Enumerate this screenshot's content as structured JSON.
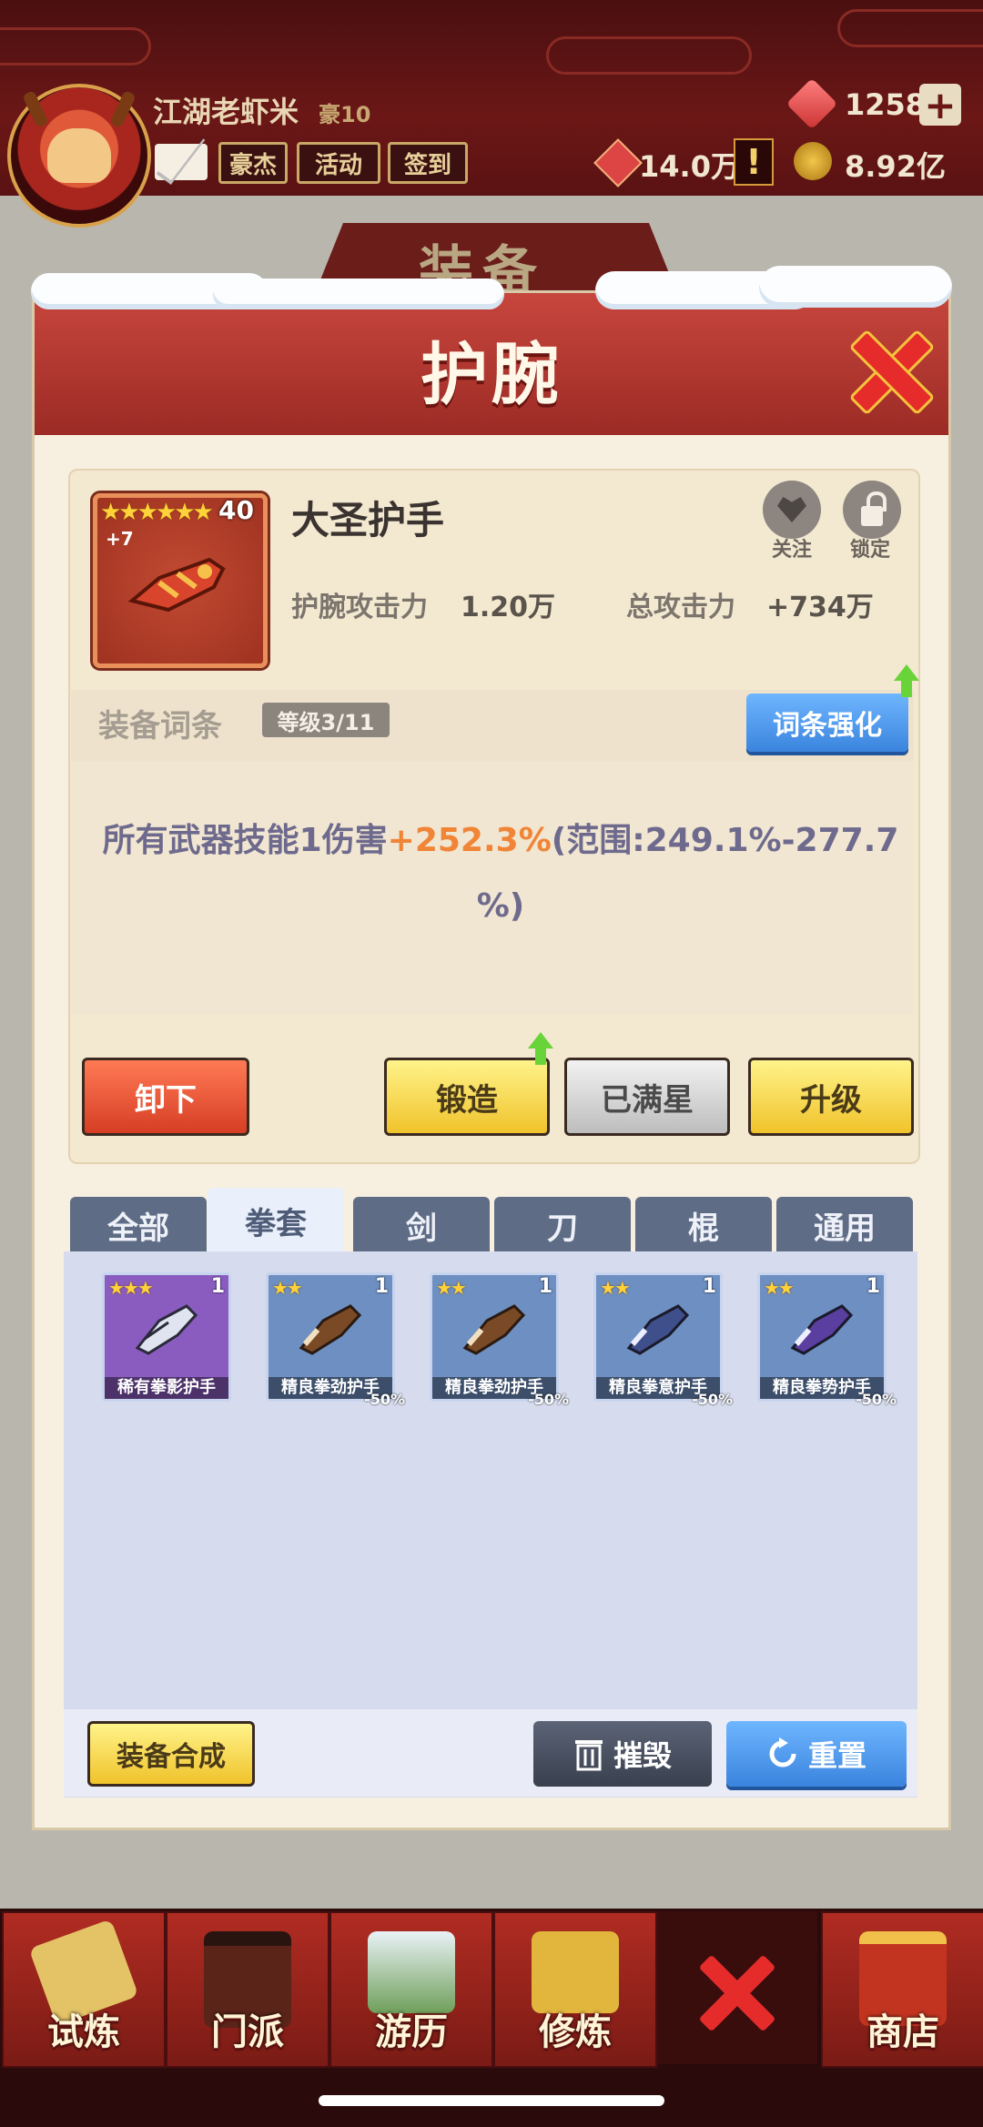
{
  "player": {
    "name": "江湖老虾米",
    "rank": "豪10",
    "gems": "1258",
    "power": "14.0万",
    "coins": "8.92亿"
  },
  "topbar_buttons": [
    "豪杰",
    "活动",
    "签到"
  ],
  "background_title": "装备",
  "dialog": {
    "title": "护腕"
  },
  "item": {
    "stars": "★★★★★★",
    "level": "40",
    "enhance": "+7",
    "name": "大圣护手",
    "stat_label": "护腕攻击力",
    "stat_value": "1.20万",
    "total_label": "总攻击力",
    "total_value": "+734万",
    "follow_label": "关注",
    "lock_label": "锁定"
  },
  "affix": {
    "title": "装备词条",
    "level_badge": "等级3/11",
    "enhance_button": "词条强化",
    "text_prefix": "所有武器技能1伤害",
    "text_value": "+252.3%",
    "text_range": "(范围:249.1%-277.7",
    "text_tail": "%)"
  },
  "actions": {
    "unequip": "卸下",
    "forge": "锻造",
    "maxstar": "已满星",
    "upgrade": "升级"
  },
  "tabs": [
    "全部",
    "拳套",
    "剑",
    "刀",
    "棍",
    "通用"
  ],
  "active_tab": "拳套",
  "inventory": [
    {
      "stars": "★★★",
      "count": "1",
      "name": "稀有拳影护手",
      "discount": "",
      "bg": "#8a5cc0"
    },
    {
      "stars": "★★",
      "count": "1",
      "name": "精良拳劲护手",
      "discount": "-50%",
      "bg": "#6d8fc2"
    },
    {
      "stars": "★★",
      "count": "1",
      "name": "精良拳劲护手",
      "discount": "-50%",
      "bg": "#6d8fc2"
    },
    {
      "stars": "★★",
      "count": "1",
      "name": "精良拳意护手",
      "discount": "-50%",
      "bg": "#6d8fc2"
    },
    {
      "stars": "★★",
      "count": "1",
      "name": "精良拳势护手",
      "discount": "-50%",
      "bg": "#6d8fc2"
    }
  ],
  "bottom_actions": {
    "compose": "装备合成",
    "destroy": "摧毁",
    "reset": "重置"
  },
  "nav": [
    "试炼",
    "门派",
    "游历",
    "修炼",
    "",
    "商店"
  ]
}
